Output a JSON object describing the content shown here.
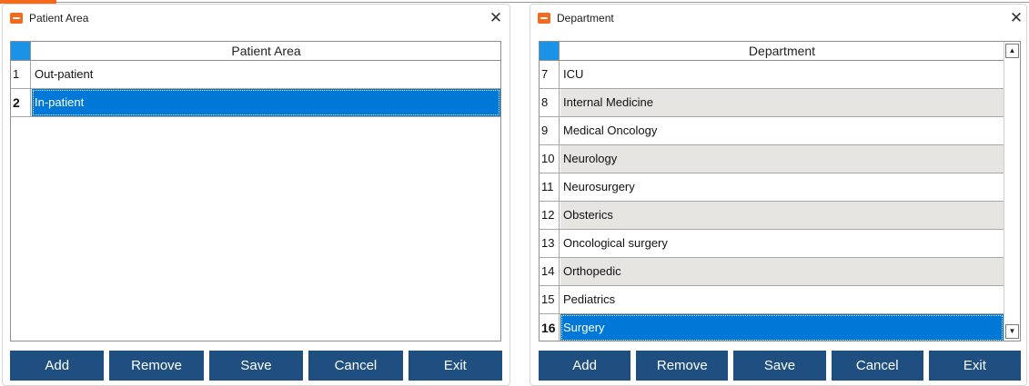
{
  "patient_area_window": {
    "title": "Patient Area",
    "close_glyph": "✕",
    "icon": "app-icon",
    "grid": {
      "header": "Patient Area",
      "rows": [
        {
          "num": "1",
          "value": "Out-patient",
          "selected": false
        },
        {
          "num": "2",
          "value": "In-patient",
          "selected": true
        }
      ]
    },
    "buttons": {
      "add": "Add",
      "remove": "Remove",
      "save": "Save",
      "cancel": "Cancel",
      "exit": "Exit"
    }
  },
  "department_window": {
    "title": "Department",
    "close_glyph": "✕",
    "icon": "app-icon",
    "grid": {
      "header": "Department",
      "rows": [
        {
          "num": "7",
          "value": "ICU",
          "selected": false
        },
        {
          "num": "8",
          "value": "Internal Medicine",
          "selected": false
        },
        {
          "num": "9",
          "value": "Medical Oncology",
          "selected": false
        },
        {
          "num": "10",
          "value": "Neurology",
          "selected": false
        },
        {
          "num": "11",
          "value": "Neurosurgery",
          "selected": false
        },
        {
          "num": "12",
          "value": "Obsterics",
          "selected": false
        },
        {
          "num": "13",
          "value": "Oncological surgery",
          "selected": false
        },
        {
          "num": "14",
          "value": "Orthopedic",
          "selected": false
        },
        {
          "num": "15",
          "value": "Pediatrics",
          "selected": false
        },
        {
          "num": "16",
          "value": "Surgery",
          "selected": true
        }
      ]
    },
    "scroll": {
      "up": "▲",
      "down": "▼"
    },
    "buttons": {
      "add": "Add",
      "remove": "Remove",
      "save": "Save",
      "cancel": "Cancel",
      "exit": "Exit"
    }
  },
  "colors": {
    "accent": "#f26b1d",
    "selection": "#0078d7",
    "button": "#1f4f80",
    "header_corner": "#1a92e6",
    "alt_row": "#e7e5e1"
  }
}
